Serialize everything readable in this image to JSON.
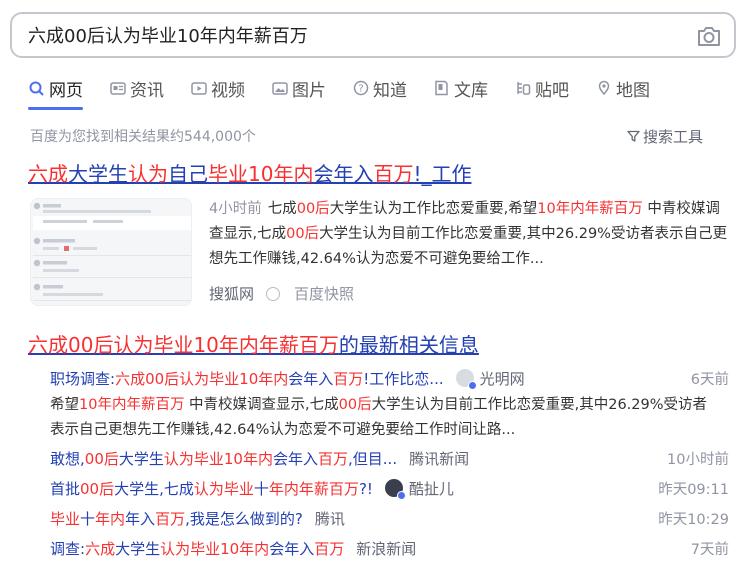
{
  "search": {
    "query": "六成00后认为毕业10年内年薪百万"
  },
  "tabs": [
    {
      "label": "网页",
      "icon": "search-icon"
    },
    {
      "label": "资讯",
      "icon": "news-icon"
    },
    {
      "label": "视频",
      "icon": "video-icon"
    },
    {
      "label": "图片",
      "icon": "image-icon"
    },
    {
      "label": "知道",
      "icon": "question-icon"
    },
    {
      "label": "文库",
      "icon": "document-icon"
    },
    {
      "label": "贴吧",
      "icon": "tieba-icon"
    },
    {
      "label": "地图",
      "icon": "map-icon"
    }
  ],
  "result_count": "百度为您找到相关结果约544,000个",
  "search_tools": "搜索工具",
  "result1": {
    "title": [
      {
        "t": "六成",
        "h": true
      },
      {
        "t": "大学生",
        "h": false
      },
      {
        "t": "认为",
        "h": true
      },
      {
        "t": "自己",
        "h": false
      },
      {
        "t": "毕业10年内",
        "h": true
      },
      {
        "t": "会年入",
        "h": false
      },
      {
        "t": "百万",
        "h": true
      },
      {
        "t": "!_工作",
        "h": false
      }
    ],
    "time": "4小时前",
    "abstract": [
      {
        "t": "七成",
        "h": false
      },
      {
        "t": "00后",
        "h": true
      },
      {
        "t": "大学生认为工作比恋爱重要,希望",
        "h": false
      },
      {
        "t": "10年内年薪百万",
        "h": true
      },
      {
        "t": " 中青校媒调查显示,七成",
        "h": false
      },
      {
        "t": "00后",
        "h": true
      },
      {
        "t": "大学生认为目前工作比恋爱重要,其中26.29%受访者表示自己更想先工作赚钱,42.64%认为恋爱不可避免要给工作...",
        "h": false
      }
    ],
    "source": "搜狐网",
    "snapshot": "百度快照"
  },
  "result2": {
    "title": [
      {
        "t": "六成00后认为毕业10年内年薪百万",
        "h": true
      },
      {
        "t": "的最新相关信息",
        "h": false
      }
    ],
    "news": [
      {
        "title": [
          {
            "t": "职场调查:",
            "h": false
          },
          {
            "t": "六成00后认为毕业10年内",
            "h": true
          },
          {
            "t": "会年入",
            "h": false
          },
          {
            "t": "百万",
            "h": true
          },
          {
            "t": "!工作比恋...",
            "h": false
          }
        ],
        "source": "光明网",
        "time": "6天前"
      },
      {
        "title": [
          {
            "t": "敢想,",
            "h": false
          },
          {
            "t": "00后",
            "h": true
          },
          {
            "t": "大学生",
            "h": false
          },
          {
            "t": "认为毕业10年内",
            "h": true
          },
          {
            "t": "会年入",
            "h": false
          },
          {
            "t": "百万",
            "h": true
          },
          {
            "t": ",但目...",
            "h": false
          }
        ],
        "source": "腾讯新闻",
        "time": "10小时前"
      },
      {
        "title": [
          {
            "t": "首批",
            "h": false
          },
          {
            "t": "00后",
            "h": true
          },
          {
            "t": "大学生,七成",
            "h": false
          },
          {
            "t": "认为毕业",
            "h": true
          },
          {
            "t": "十",
            "h": false
          },
          {
            "t": "年内年薪百万",
            "h": true
          },
          {
            "t": "?!",
            "h": false
          }
        ],
        "source": "酷扯儿",
        "time": "昨天09:11"
      },
      {
        "title": [
          {
            "t": "毕业",
            "h": true
          },
          {
            "t": "十",
            "h": false
          },
          {
            "t": "年内",
            "h": true
          },
          {
            "t": "年入",
            "h": false
          },
          {
            "t": "百万",
            "h": true
          },
          {
            "t": ",我是怎么做到的?",
            "h": false
          }
        ],
        "source": "腾讯",
        "time": "昨天10:29"
      },
      {
        "title": [
          {
            "t": "调查:",
            "h": false
          },
          {
            "t": "六成",
            "h": true
          },
          {
            "t": "大学生",
            "h": false
          },
          {
            "t": "认为毕业10年内",
            "h": true
          },
          {
            "t": "会年入",
            "h": false
          },
          {
            "t": "百万",
            "h": true
          }
        ],
        "source": "新浪新闻",
        "time": "7天前"
      }
    ],
    "abstract": [
      {
        "t": "希望",
        "h": false
      },
      {
        "t": "10年内年薪百万",
        "h": true
      },
      {
        "t": " 中青校媒调查显示,七成",
        "h": false
      },
      {
        "t": "00后",
        "h": true
      },
      {
        "t": "大学生认为目前工作比恋爱重要,其中26.29%受访者表示自己更想先工作赚钱,42.64%认为恋爱不可避免要给工作时间让路...",
        "h": false
      }
    ]
  },
  "colors": {
    "accent": "#4e6ef2",
    "link": "#2440b3",
    "highlight": "#f73131",
    "muted": "#9195a3"
  }
}
